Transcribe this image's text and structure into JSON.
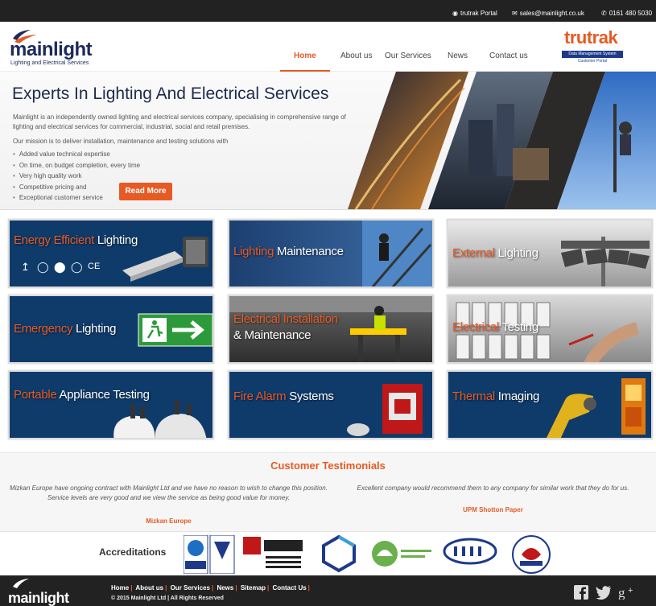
{
  "topbar": {
    "portal_label": "trutrak Portal",
    "email": "sales@mainlight.co.uk",
    "phone": "0161 480 5030"
  },
  "logo": {
    "name": "mainlight",
    "tagline": "Lighting and Electrical Services"
  },
  "nav": {
    "items": [
      {
        "label": "Home",
        "active": true
      },
      {
        "label": "About us",
        "active": false
      },
      {
        "label": "Our Services",
        "active": false
      },
      {
        "label": "News",
        "active": false
      },
      {
        "label": "Contact us",
        "active": false
      }
    ]
  },
  "trutrak": {
    "name": "trutrak",
    "band": "Data Management System",
    "sub": "Customer Portal"
  },
  "hero": {
    "title": "Experts In Lighting And Electrical Services",
    "intro": "Mainlight is an independently owned lighting and electrical services company, specialising in comprehensive range of lighting and electrical services for commercial, industrial, social and retail premises.",
    "mission": "Our mission is to deliver installation, maintenance and testing solutions with",
    "bullets": [
      "Added value technical expertise",
      "On time, on budget completion, every time",
      "Very high quality work",
      "Competitive pricing and",
      "Exceptional customer service"
    ],
    "cta": "Read More"
  },
  "services": [
    {
      "highlight": "Energy Efficient",
      "rest": " Lighting",
      "line2": ""
    },
    {
      "highlight": "Lighting",
      "rest": " Maintenance",
      "line2": ""
    },
    {
      "highlight": "External",
      "rest": " Lighting",
      "line2": ""
    },
    {
      "highlight": "Emergency",
      "rest": " Lighting",
      "line2": ""
    },
    {
      "highlight": "Electrical Installation",
      "rest": "",
      "line2": "& Maintenance"
    },
    {
      "highlight": "Electrical",
      "rest": " Testing",
      "line2": ""
    },
    {
      "highlight": "Portable",
      "rest": " Appliance Testing",
      "line2": ""
    },
    {
      "highlight": "Fire Alarm",
      "rest": " Systems",
      "line2": ""
    },
    {
      "highlight": "Thermal",
      "rest": " Imaging",
      "line2": ""
    }
  ],
  "testimonials": {
    "heading": "Customer Testimonials",
    "items": [
      {
        "quote": "Mizkan Europe have ongoing contract with Mainlight Ltd and we have no reason to wish to change this position. Service levels are very good and we view the service as being good value for money.",
        "author": "Mizkan Europe"
      },
      {
        "quote": "Excellent company would recommend them to any company for similar work that they do for us.",
        "author": "UPM Shotton Paper"
      }
    ]
  },
  "accreditations": {
    "label": "Accreditations",
    "logos": [
      "ISOQAR",
      "UKAS",
      "NICEIC APPROVED CONTRACTOR",
      "constructionline",
      "Environment Agency",
      "CHAS",
      "SafeContractor APPROVED"
    ]
  },
  "footer": {
    "logo": "mainlight",
    "links": [
      "Home",
      "About us",
      "Our Services",
      "News",
      "Sitemap",
      "Contact Us"
    ],
    "copyright": "© 2015 Mainlight Ltd | All Rights Reserved",
    "social": [
      "facebook-icon",
      "twitter-icon",
      "google-plus-icon"
    ]
  },
  "colors": {
    "accent": "#e65a24",
    "navy": "#1d2a5a",
    "tile_blue": "#0f3b6b",
    "dark": "#222222"
  }
}
